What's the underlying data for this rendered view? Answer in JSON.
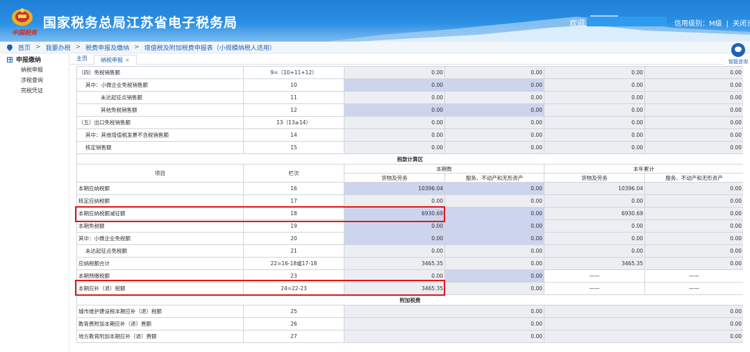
{
  "header": {
    "site_title": "国家税务总局江苏省电子税务局",
    "seal_text": "中国税务",
    "welcome": "欢迎",
    "credit_level": "信用级别：M级",
    "divider": "|",
    "close_page": "关闭当页"
  },
  "breadcrumb": [
    "首页",
    "我要办税",
    "税费申报及缴纳",
    "增值税及附加税费申报表（小规模纳税人适用）"
  ],
  "breadcrumb_sep": ">",
  "sidebar": {
    "head": "申报缴纳",
    "items": [
      "纳税申报",
      "涉税查询",
      "完税凭证"
    ]
  },
  "tabs": [
    {
      "label": "主页"
    },
    {
      "label": "纳税申报",
      "close": "×"
    }
  ],
  "consult_label": "智能咨询",
  "top_rows": [
    {
      "item": "（四）免税销售额",
      "line": "9=（10+11+12）",
      "v1": "0.00",
      "v2": "0.00",
      "v3": "0.00",
      "v4": "0.00",
      "indent": 0,
      "b1": false,
      "b2": false
    },
    {
      "item": "其中：小微企业免税销售额",
      "line": "10",
      "v1": "0.00",
      "v2": "0.00",
      "v3": "0.00",
      "v4": "0.00",
      "indent": 1,
      "b1": true,
      "b2": true
    },
    {
      "item": "未达起征点销售额",
      "line": "11",
      "v1": "0.00",
      "v2": "0.00",
      "v3": "0.00",
      "v4": "0.00",
      "indent": 2,
      "b1": false,
      "b2": false
    },
    {
      "item": "其他免税销售额",
      "line": "12",
      "v1": "0.00",
      "v2": "0.00",
      "v3": "0.00",
      "v4": "0.00",
      "indent": 2,
      "b1": true,
      "b2": true
    },
    {
      "item": "（五）出口免税销售额",
      "line": "13（13≥14）",
      "v1": "0.00",
      "v2": "0.00",
      "v3": "0.00",
      "v4": "0.00",
      "indent": 0,
      "b1": false,
      "b2": false
    },
    {
      "item": "其中：其他增值税发票不含税销售额",
      "line": "14",
      "v1": "0.00",
      "v2": "0.00",
      "v3": "0.00",
      "v4": "0.00",
      "indent": 1,
      "b1": false,
      "b2": false
    },
    {
      "item": "核定销售额",
      "line": "15",
      "v1": "0.00",
      "v2": "0.00",
      "v3": "0.00",
      "v4": "0.00",
      "indent": 1,
      "b1": false,
      "b2": false
    }
  ],
  "tax_section": {
    "title": "税款计算区",
    "col_item": "项目",
    "col_line": "栏次",
    "col_current": "本期数",
    "col_ytd": "本年累计",
    "sub_goods": "货物及劳务",
    "sub_services": "服务、不动产和无形资产"
  },
  "tax_rows": [
    {
      "item": "本期应纳税额",
      "line": "16",
      "v1": "10396.04",
      "v2": "0.00",
      "v3": "10396.04",
      "v4": "0.00",
      "indent": 0,
      "b1": true,
      "b2": true
    },
    {
      "item": "核定应纳税额",
      "line": "17",
      "v1": "0.00",
      "v2": "0.00",
      "v3": "0.00",
      "v4": "0.00",
      "indent": 0,
      "b1": false,
      "b2": false
    },
    {
      "item": "本期应纳税额减征额",
      "line": "18",
      "v1": "6930.69",
      "v2": "0.00",
      "v3": "6930.69",
      "v4": "0.00",
      "indent": 0,
      "b1": true,
      "b2": true
    },
    {
      "item": "本期免税额",
      "line": "19",
      "v1": "0.00",
      "v2": "0.00",
      "v3": "0.00",
      "v4": "0.00",
      "indent": 0,
      "b1": true,
      "b2": true
    },
    {
      "item": "其中：小微企业免税额",
      "line": "20",
      "v1": "0.00",
      "v2": "0.00",
      "v3": "0.00",
      "v4": "0.00",
      "indent": 0,
      "b1": true,
      "b2": true
    },
    {
      "item": "未达起征点免税额",
      "line": "21",
      "v1": "0.00",
      "v2": "0.00",
      "v3": "0.00",
      "v4": "0.00",
      "indent": 1,
      "b1": false,
      "b2": false
    },
    {
      "item": "应纳税额合计",
      "line": "22=16-18或17-18",
      "v1": "3465.35",
      "v2": "0.00",
      "v3": "3465.35",
      "v4": "0.00",
      "indent": 0,
      "b1": false,
      "b2": false
    },
    {
      "item": "本期预缴税额",
      "line": "23",
      "v1": "0.00",
      "v2": "0.00",
      "v3": "——",
      "v4": "——",
      "indent": 0,
      "b1": false,
      "b2": true,
      "dash": true
    },
    {
      "item": "本期应补（退）税额",
      "line": "24=22-23",
      "v1": "3465.35",
      "v2": "0.00",
      "v3": "——",
      "v4": "——",
      "indent": 0,
      "b1": false,
      "b2": false,
      "dash": true
    }
  ],
  "surcharge_section": {
    "title": "附加税费"
  },
  "surcharge_rows": [
    {
      "item": "城市维护建设税本期应补（退）税额",
      "line": "25",
      "v_current": "0.00",
      "v_ytd": "0.00"
    },
    {
      "item": "教育费附加本期应补（退）费额",
      "line": "26",
      "v_current": "0.00",
      "v_ytd": "0.00"
    },
    {
      "item": "地方教育附加本期应补（退）费额",
      "line": "27",
      "v_current": "0.00",
      "v_ytd": "0.00"
    }
  ],
  "colors": {
    "accent": "#1b62b7",
    "highlight": "#e3141b",
    "editable_cell": "#cdd4ee",
    "readonly_cell": "#eceef2"
  }
}
